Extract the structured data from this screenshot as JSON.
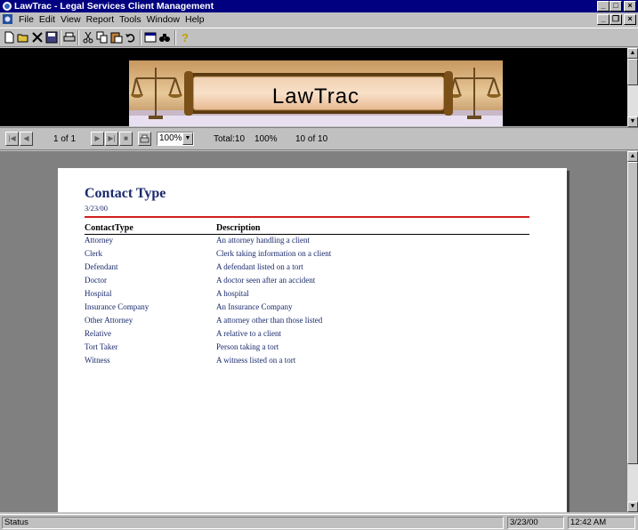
{
  "window": {
    "title": "LawTrac - Legal Services Client Management"
  },
  "menu": {
    "items": [
      "File",
      "Edit",
      "View",
      "Report",
      "Tools",
      "Window",
      "Help"
    ]
  },
  "toolbar": {
    "icons": [
      "new-file-icon",
      "open-folder-icon",
      "close-x-icon",
      "save-icon",
      "print-icon",
      "cut-icon",
      "copy-icon",
      "paste-icon",
      "undo-icon",
      "properties-icon",
      "find-icon",
      "help-icon"
    ]
  },
  "banner": {
    "title": "LawTrac"
  },
  "navigation": {
    "page_indicator": "1 of 1",
    "zoom": "100%",
    "total": "Total:10",
    "percent": "100%",
    "record_count": "10 of 10"
  },
  "report": {
    "title": "Contact Type",
    "date": "3/23/00",
    "columns": [
      "ContactType",
      "Description"
    ],
    "rows": [
      {
        "type": "Attorney",
        "description": "An attorney handling a client"
      },
      {
        "type": "Clerk",
        "description": "Clerk taking information on a client"
      },
      {
        "type": "Defendant",
        "description": "A defendant listed on a tort"
      },
      {
        "type": "Doctor",
        "description": "A doctor seen after an accident"
      },
      {
        "type": "Hospital",
        "description": "A hospital"
      },
      {
        "type": "Insurance Company",
        "description": "An Insurance Company"
      },
      {
        "type": "Other Attorney",
        "description": "A attorney other than those listed"
      },
      {
        "type": "Relative",
        "description": "A relative to a client"
      },
      {
        "type": "Tort Taker",
        "description": "Person taking a tort"
      },
      {
        "type": "Witness",
        "description": "A witness listed on a tort"
      }
    ]
  },
  "statusbar": {
    "status": "Status",
    "date": "3/23/00",
    "time": "12:42 AM"
  },
  "colors": {
    "titlebar": "#000080",
    "report_text": "#1a2a6c",
    "rule": "#d02020"
  }
}
